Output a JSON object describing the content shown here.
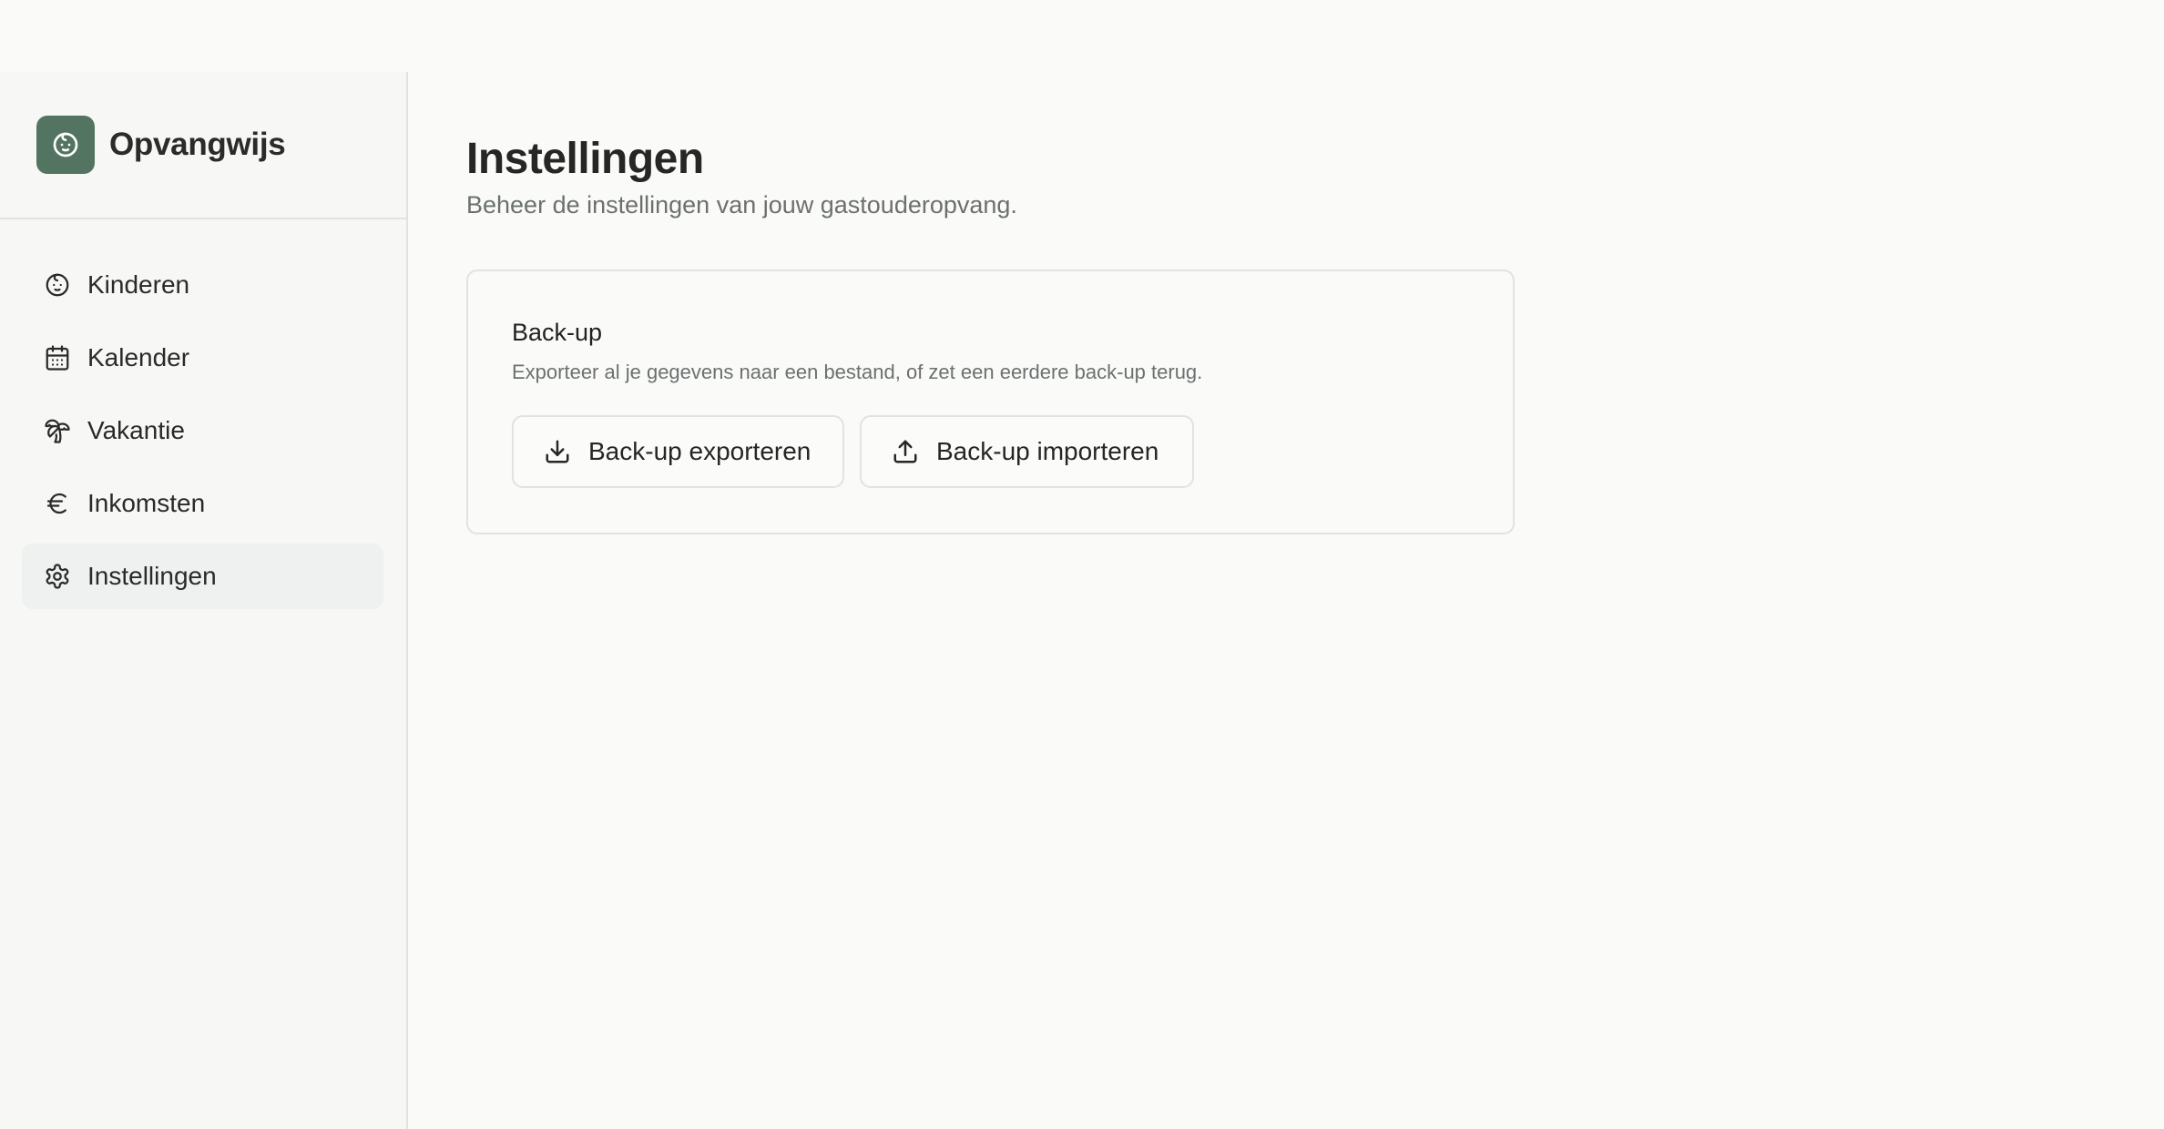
{
  "app": {
    "name": "Opvangwijs",
    "accent": "#547462"
  },
  "sidebar": {
    "items": [
      {
        "label": "Kinderen",
        "icon": "baby-face-icon",
        "active": false
      },
      {
        "label": "Kalender",
        "icon": "calendar-icon",
        "active": false
      },
      {
        "label": "Vakantie",
        "icon": "palm-tree-icon",
        "active": false
      },
      {
        "label": "Inkomsten",
        "icon": "euro-icon",
        "active": false
      },
      {
        "label": "Instellingen",
        "icon": "gear-icon",
        "active": true
      }
    ]
  },
  "page": {
    "title": "Instellingen",
    "subtitle": "Beheer de instellingen van jouw gastouderopvang."
  },
  "backup": {
    "title": "Back-up",
    "description": "Exporteer al je gegevens naar een bestand, of zet een eerdere back-up terug.",
    "export_label": "Back-up exporteren",
    "export_icon": "download-icon",
    "import_label": "Back-up importeren",
    "import_icon": "upload-icon"
  }
}
